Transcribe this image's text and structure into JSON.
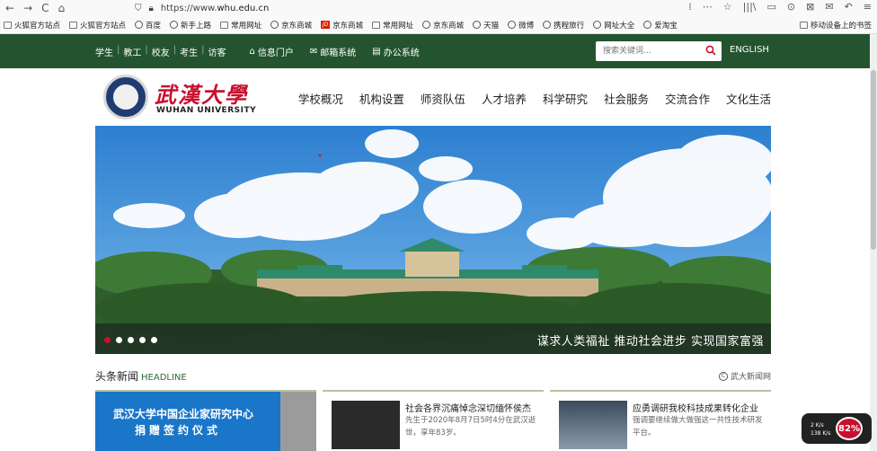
{
  "browser": {
    "url_prefix": "https://www.",
    "url_host": "whu.edu.cn",
    "nav": [
      "←",
      "→",
      "C",
      "⌂"
    ],
    "icons": [
      "⁞",
      "⋯",
      "☆",
      "|||\\",
      "▭",
      "⊙",
      "⊠",
      "✉",
      "↶",
      "≡"
    ]
  },
  "bookmarks": {
    "items": [
      "火狐官方站点",
      "火狐官方站点",
      "百度",
      "新手上路",
      "常用网址",
      "京东商城",
      "京东商城",
      "常用网址",
      "京东商城",
      "天猫",
      "微博",
      "携程旅行",
      "网址大全",
      "爱淘宝"
    ],
    "jd_badge": "JD",
    "mobile": "移动设备上的书签"
  },
  "topbar": {
    "identities": [
      "学生",
      "教工",
      "校友",
      "考生",
      "访客"
    ],
    "links": [
      "信息门户",
      "邮箱系统",
      "办公系统"
    ],
    "search_placeholder": "搜索关键词...",
    "english": "ENGLISH"
  },
  "header": {
    "logo_cn": "武漢大學",
    "logo_en": "WUHAN UNIVERSITY",
    "nav": [
      "学校概况",
      "机构设置",
      "师资队伍",
      "人才培养",
      "科学研究",
      "社会服务",
      "交流合作",
      "文化生活"
    ]
  },
  "banner": {
    "slogan": "谋求人类福祉 推动社会进步 实现国家富强",
    "slide_count": 5,
    "active_slide": 1
  },
  "news": {
    "title": "头条新闻",
    "title_en": "HEADLINE",
    "source_mark": "C",
    "source": "武大新闻网",
    "card1_line1": "武汉大学中国企业家研究中心",
    "card1_line2": "捐赠签约仪式",
    "items": [
      {
        "title": "社会各界沉痛悼念深切缅怀侯杰",
        "desc": "先生于2020年8月7日5时4分在武汉逝世，享年83岁。"
      },
      {
        "title": "应勇调研我校科技成果转化企业",
        "desc": "强调要继续做大做强这一共性技术研发平台。"
      }
    ]
  },
  "widget": {
    "up": "2 K/s",
    "down": "138 K/s",
    "percent": "82%"
  },
  "colors": {
    "topbar": "#24542f",
    "accent_red": "#c8102e",
    "card_blue": "#1976c8"
  }
}
